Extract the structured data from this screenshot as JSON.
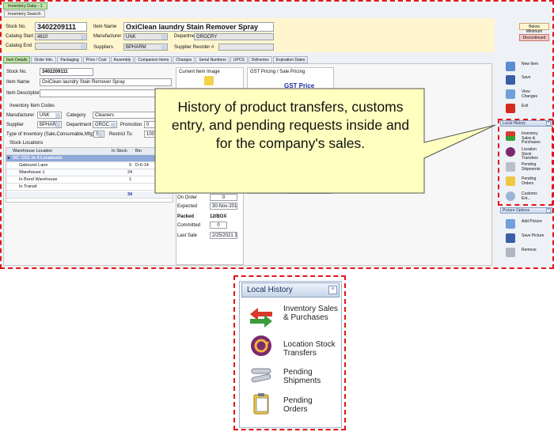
{
  "window": {
    "title": "Inventory Data - 1",
    "subtab": "Inventory Search"
  },
  "header": {
    "stock_no_label": "Stock No.",
    "stock_no": "3402209111",
    "item_name_label": "Item Name",
    "item_name": "OxiClean laundry Stain Remover Spray",
    "catalog_start_label": "Catalog Start",
    "catalog_start": "4810",
    "manufacturer_label": "Manufacturer",
    "manufacturer": "UNK",
    "department_label": "Department",
    "department": "GROCRY",
    "catalog_end_label": "Catalog End",
    "suppliers_label": "Suppliers",
    "suppliers": "BPHARM",
    "supplier_reorder_label": "Supplier Reorder #",
    "status_below_min": "Below Minimum",
    "status_discontinued": "Discontinued"
  },
  "tabs": [
    "Item Details",
    "Order Info.",
    "Packaging",
    "Price / Cost",
    "Assembly",
    "Companion Items",
    "Changes",
    "Serial Numbers",
    "UPCS",
    "Deliveries",
    "Expiration Dates"
  ],
  "details": {
    "stock_no_label": "Stock No.",
    "stock_no": "3402209111",
    "item_name_label": "Item Name",
    "item_name": "OxiClean laundry Stain Remover Spray",
    "item_desc_label": "Item Description",
    "codes_title": "Inventory Item Codes",
    "manufacturer_label": "Manufacturer",
    "manufacturer": "UNK",
    "category_label": "Category",
    "category": "Cleaners",
    "supplier_label": "Supplier",
    "supplier": "BPHARM",
    "department_label": "Department",
    "department": "GROC...",
    "promotion_label": "Promotion",
    "promotion": "0",
    "type_label": "Type of Inventory (Sale,Consumable,Mfg)",
    "type_value": "S",
    "restrict_label": "Restrict To:",
    "restrict_value": "100"
  },
  "stock_locations": {
    "title": "Stock Locations",
    "columns": [
      "Warehouse Location",
      "In Stock",
      "Bin"
    ],
    "group_row": "DC: CCL In 4 Location/s",
    "rows": [
      {
        "location": "Gabourel Lane",
        "in_stock": "9",
        "bin": "D-6-14"
      },
      {
        "location": "Warehouse 1",
        "in_stock": "24",
        "bin": ""
      },
      {
        "location": "In Bond Warehouse",
        "in_stock": "1",
        "bin": ""
      },
      {
        "location": "In Transit",
        "in_stock": "",
        "bin": ""
      }
    ],
    "total": "34"
  },
  "current_image_title": "Current Item Image",
  "gst_title": "GST Pricing / Sale Pricing",
  "gst_price_label": "GST Price",
  "order_info": {
    "on_order_label": "On Order",
    "on_order": "0",
    "expected_label": "Expected",
    "expected": "30-Nov-2010",
    "packed_label": "Packed",
    "packed": "12/BOX",
    "committed_label": "Committed",
    "committed": "0",
    "last_sale_label": "Last Sale",
    "last_sale": "2/25/2021 3:"
  },
  "sidebar": {
    "new_item": "New Item",
    "save": "Save",
    "view_changes": "View Changes",
    "exit": "Exit",
    "local_history_title": "Local History",
    "lh_items": [
      "Inventory Sales & Purchases",
      "Location Stock Transfers",
      "Pending Shipments",
      "Pending Orders",
      "Customs Ent..."
    ],
    "picture_options_title": "Picture Options",
    "po_items": [
      "Add Picture",
      "Save Picture",
      "Remove"
    ]
  },
  "callout": "History of product transfers, customs entry, and pending requests inside and for the company's sales.",
  "zoom": {
    "title": "Local History",
    "items": [
      "Inventory Sales & Purchases",
      "Location Stock Transfers",
      "Pending Shipments",
      "Pending Orders"
    ]
  },
  "colors": {
    "highlight_red": "#e3131b",
    "header_yellow": "#fff6cf",
    "active_tab_green": "#bfe4a8",
    "callout_fill": "#ffffc0"
  }
}
